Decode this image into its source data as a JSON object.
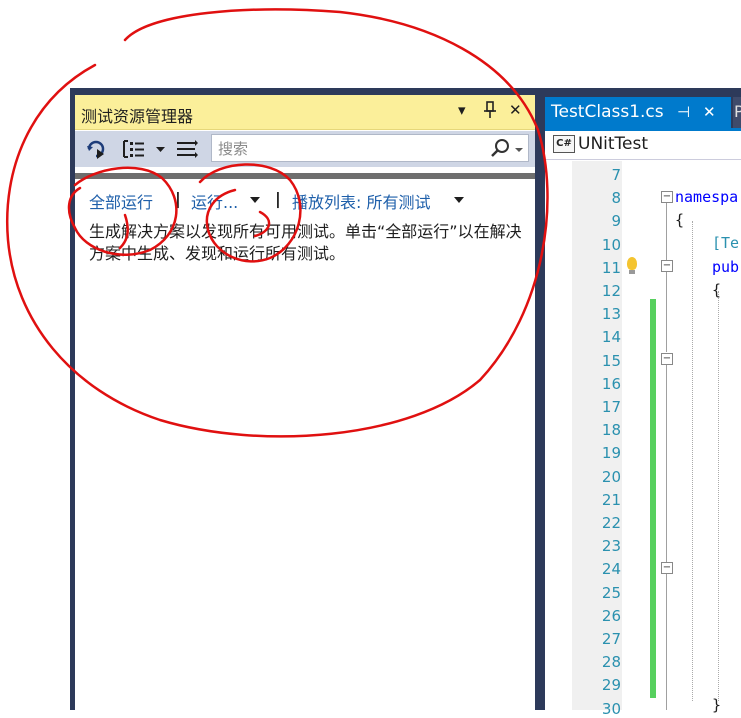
{
  "test_explorer": {
    "title": "测试资源管理器",
    "pin_glyph": "▾",
    "pin2_glyph": "⊥",
    "close_glyph": "✕",
    "search_placeholder": "搜索",
    "run_all_label": "全部运行",
    "run_label": "运行...",
    "playlist_label": "播放列表: 所有测试",
    "separator": "|",
    "message": "生成解决方案以发现所有可用测试。单击“全部运行”以在解决方案中生成、发现和运行所有测试。"
  },
  "editor": {
    "tab_label": "TestClass1.cs",
    "tab_pin_glyph": "⊣",
    "tab_close_glyph": "✕",
    "next_tab_glyph": "P",
    "nav_icon_text": "C#",
    "nav_label": "UNitTest",
    "line_numbers": [
      "7",
      "8",
      "9",
      "10",
      "11",
      "12",
      "13",
      "14",
      "15",
      "16",
      "17",
      "18",
      "19",
      "20",
      "21",
      "22",
      "23",
      "24",
      "25",
      "26",
      "27",
      "28",
      "29",
      "30"
    ],
    "code_keyword": "namespa",
    "code_brace": "{",
    "code_attr": "[Te",
    "code_pub": "pub",
    "code_brace2": "{",
    "code_close": "}"
  },
  "colors": {
    "panel_title_bg": "#fbef9a",
    "tab_active": "#007acc",
    "link": "#1e5faa",
    "annotation": "#e01010"
  },
  "icons": [
    "run-test-icon",
    "group-by-icon",
    "dropdown-icon",
    "playlist-icon",
    "search-icon"
  ]
}
